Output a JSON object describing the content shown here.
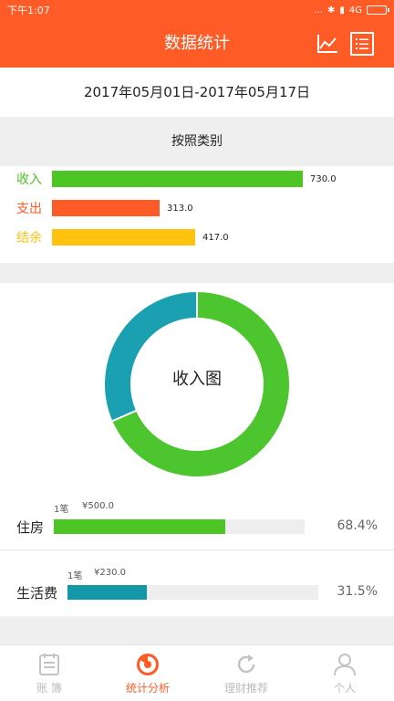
{
  "statusbar": {
    "time": "下午1:07",
    "dots": "...",
    "network": "4G"
  },
  "appbar": {
    "title": "数据统计"
  },
  "date_range": "2017年05月01日-2017年05月17日",
  "category_label": "按照类别",
  "summary": [
    {
      "label": "收入",
      "value": "730.0",
      "amount": 730.0,
      "color": "#4dc524"
    },
    {
      "label": "支出",
      "value": "313.0",
      "amount": 313.0,
      "color": "#ff5b26"
    },
    {
      "label": "结余",
      "value": "417.0",
      "amount": 417.0,
      "color": "#ffc20e"
    }
  ],
  "pie": {
    "center_label": "收入图",
    "slices": [
      {
        "name": "住房",
        "value": 500.0,
        "color": "#4dc52e"
      },
      {
        "name": "生活费",
        "value": 230.0,
        "color": "#1aa0b0"
      }
    ]
  },
  "items": [
    {
      "count": "1笔",
      "amount": "¥500.0",
      "name": "住房",
      "percent": "68.4%",
      "fraction": 0.684,
      "color": "#4dc524"
    },
    {
      "count": "1笔",
      "amount": "¥230.0",
      "name": "生活费",
      "percent": "31.5%",
      "fraction": 0.315,
      "color": "#1498a8"
    }
  ],
  "nav": [
    {
      "label": "账 簿",
      "icon": "ledger-icon"
    },
    {
      "label": "统计分析",
      "icon": "pie-chart-icon"
    },
    {
      "label": "理财推荐",
      "icon": "refresh-icon"
    },
    {
      "label": "个人",
      "icon": "person-icon"
    }
  ],
  "colors": {
    "accent": "#ff5b26",
    "income": "#4dc524",
    "expense": "#ff5b26",
    "balance": "#ffc20e"
  }
}
